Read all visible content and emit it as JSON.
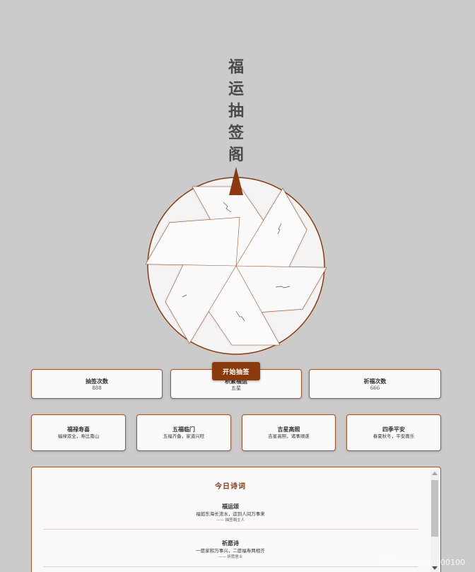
{
  "title_chars": [
    "福",
    "运",
    "抽",
    "签",
    "阁"
  ],
  "start_button": "开始抽签",
  "stats": [
    {
      "label": "抽签次数",
      "value": "888"
    },
    {
      "label": "积累福运",
      "value": "五星"
    },
    {
      "label": "祈福次数",
      "value": "666"
    }
  ],
  "blessings": [
    {
      "title": "福禄寿喜",
      "desc": "福禄双全，寿比南山"
    },
    {
      "title": "五福临门",
      "desc": "五福齐备，家道兴旺"
    },
    {
      "title": "吉星高照",
      "desc": "吉星高照，诸事顺遂"
    },
    {
      "title": "四季平安",
      "desc": "春夏秋冬，平安喜乐"
    }
  ],
  "poems_section": {
    "title": "今日诗词",
    "poems": [
      {
        "title": "福运颂",
        "line": "福如东海长流水，运到人间万事来",
        "author": "—— 抽签阁主人"
      },
      {
        "title": "祈愿诗",
        "line": "一愿家和万事兴，二愿福寿两相齐",
        "author": "—— 祈愿居士"
      }
    ]
  },
  "watermark": "CSDN @sky10100100",
  "colors": {
    "accent": "#8b3a0e",
    "card_border": "#a0552c",
    "background": "#cbcbcb",
    "card_bg": "#fafafa",
    "title": "#4a4a4a"
  }
}
